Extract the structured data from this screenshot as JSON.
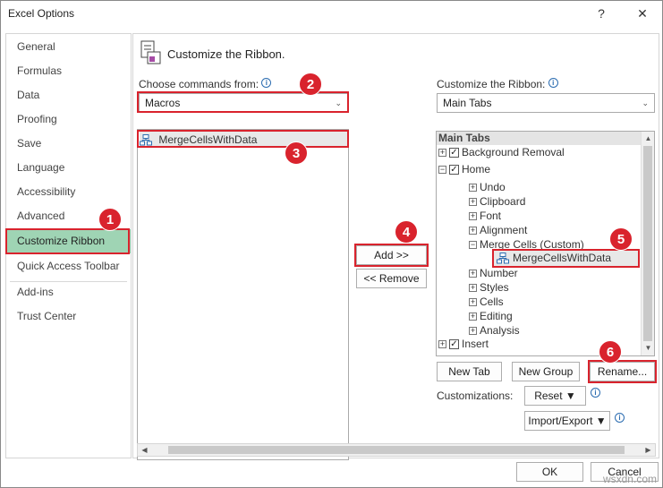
{
  "window": {
    "title": "Excel Options",
    "help_glyph": "?",
    "close_glyph": "✕"
  },
  "nav": {
    "items": [
      {
        "label": "General"
      },
      {
        "label": "Formulas"
      },
      {
        "label": "Data"
      },
      {
        "label": "Proofing"
      },
      {
        "label": "Save"
      },
      {
        "label": "Language"
      },
      {
        "label": "Accessibility"
      },
      {
        "label": "Advanced"
      },
      {
        "label": "Customize Ribbon",
        "selected": true
      },
      {
        "label": "Quick Access Toolbar"
      },
      {
        "label": "Add-ins"
      },
      {
        "label": "Trust Center"
      }
    ]
  },
  "main": {
    "heading": "Customize the Ribbon.",
    "choose_label": "Choose commands from:",
    "choose_value": "Macros",
    "commands_list": [
      "MergeCellsWithData"
    ],
    "add_button": "Add >>",
    "remove_button": "<< Remove",
    "customize_label": "Customize the Ribbon:",
    "customize_value": "Main Tabs",
    "tree": {
      "header": "Main Tabs",
      "rows": [
        {
          "label": "Background Removal",
          "level": 0,
          "expander": "+",
          "checked": true
        },
        {
          "label": "Home",
          "level": 0,
          "expander": "−",
          "checked": true
        },
        {
          "label": "Undo",
          "level": 1,
          "expander": "+"
        },
        {
          "label": "Clipboard",
          "level": 1,
          "expander": "+"
        },
        {
          "label": "Font",
          "level": 1,
          "expander": "+"
        },
        {
          "label": "Alignment",
          "level": 1,
          "expander": "+"
        },
        {
          "label": "Merge Cells (Custom)",
          "level": 1,
          "expander": "−"
        },
        {
          "label": "MergeCellsWithData",
          "level": 2,
          "macro": true
        },
        {
          "label": "Number",
          "level": 1,
          "expander": "+"
        },
        {
          "label": "Styles",
          "level": 1,
          "expander": "+"
        },
        {
          "label": "Cells",
          "level": 1,
          "expander": "+"
        },
        {
          "label": "Editing",
          "level": 1,
          "expander": "+"
        },
        {
          "label": "Analysis",
          "level": 1,
          "expander": "+"
        },
        {
          "label": "Insert",
          "level": 0,
          "expander": "+",
          "checked": true
        }
      ]
    },
    "new_tab_button": "New Tab",
    "new_group_button": "New Group",
    "rename_button": "Rename...",
    "customizations_label": "Customizations:",
    "reset_button": "Reset ▼",
    "import_export_button": "Import/Export ▼"
  },
  "footer": {
    "ok_button": "OK",
    "cancel_button": "Cancel"
  },
  "badges": [
    "1",
    "2",
    "3",
    "4",
    "5",
    "6"
  ],
  "watermark": "wsxdn.com",
  "colors": {
    "highlight": "#d9232d",
    "selected_nav": "#9fd4b4",
    "info": "#2b6cb0"
  }
}
